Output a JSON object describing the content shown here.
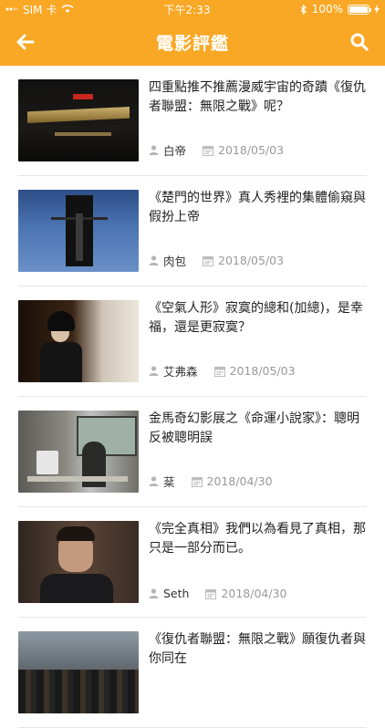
{
  "status": {
    "carrier": "SIM 卡",
    "time": "下午2:33",
    "battery": "100%",
    "battery_level": 100
  },
  "nav": {
    "title": "電影評鑑",
    "back_icon": "arrow-left-icon",
    "search_icon": "search-icon"
  },
  "colors": {
    "accent": "#F9A825",
    "meta_gray": "#999999"
  },
  "articles": [
    {
      "title": "四重點推不推薦漫威宇宙的奇蹟《復仇者聯盟：無限之戰》呢？",
      "author": "白帝",
      "date": "2018/05/03"
    },
    {
      "title": "《楚門的世界》真人秀裡的集體偷窺與假扮上帝",
      "author": "肉包",
      "date": "2018/05/03"
    },
    {
      "title": "《空氣人形》寂寞的總和(加總)，是幸福，還是更寂寞？",
      "author": "艾弗森",
      "date": "2018/05/03"
    },
    {
      "title": "金馬奇幻影展之《命運小說家》：聰明反被聰明誤",
      "author": "棻",
      "date": "2018/04/30"
    },
    {
      "title": "《完全真相》我們以為看見了真相，那只是一部分而已。",
      "author": "Seth",
      "date": "2018/04/30"
    },
    {
      "title": "《復仇者聯盟：無限之戰》願復仇者與你同在",
      "author": "",
      "date": ""
    }
  ]
}
